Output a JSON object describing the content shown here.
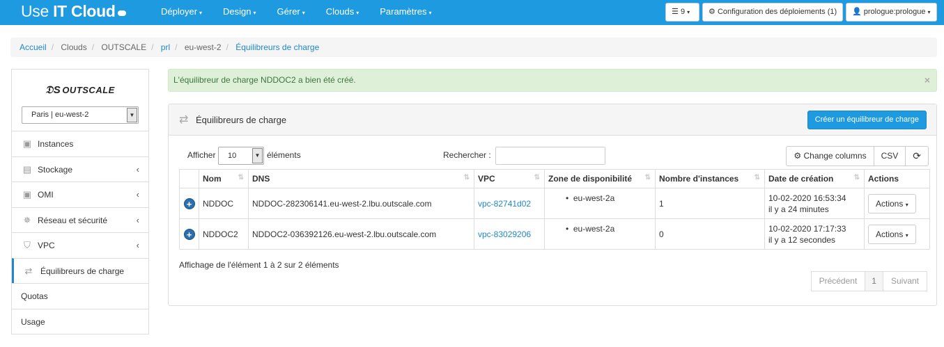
{
  "nav": {
    "brand_light": "Use ",
    "brand_bold": "IT Cloud",
    "menu": [
      "Déployer",
      "Design",
      "Gérer",
      "Clouds",
      "Paramètres"
    ],
    "tasks_count": "9",
    "config_label": "Configuration des déploiements (1)",
    "user_label": "prologue:prologue"
  },
  "breadcrumb": [
    "Accueil",
    "Clouds",
    "OUTSCALE",
    "prl",
    "eu-west-2",
    "Équilibreurs de charge"
  ],
  "sidebar": {
    "logo_text": "OUTSCALE",
    "region": "Paris | eu-west-2",
    "items": [
      {
        "label": "Instances",
        "icon": "chip-icon"
      },
      {
        "label": "Stockage",
        "icon": "storage-icon"
      },
      {
        "label": "OMI",
        "icon": "chip-icon"
      },
      {
        "label": "Réseau et sécurité",
        "icon": "network-icon"
      },
      {
        "label": "VPC",
        "icon": "shield-icon"
      },
      {
        "label": "Équilibreurs de charge",
        "icon": "exchange-icon"
      },
      {
        "label": "Quotas"
      },
      {
        "label": "Usage"
      }
    ]
  },
  "alert": {
    "message": "L'équilibreur de charge NDDOC2 a bien été créé.",
    "close": "×"
  },
  "panel": {
    "title": "Équilibreurs de charge",
    "create_button": "Créer un équilibreur de charge",
    "show_label": "Afficher",
    "page_length": "10",
    "elements_label": "éléments",
    "search_label": "Rechercher :",
    "search_value": "",
    "change_columns": "Change columns",
    "csv": "CSV"
  },
  "table": {
    "headers": [
      "Nom",
      "DNS",
      "VPC",
      "Zone de disponibilité",
      "Nombre d'instances",
      "Date de création",
      "Actions"
    ],
    "rows": [
      {
        "name": "NDDOC",
        "dns": "NDDOC-282306141.eu-west-2.lbu.outscale.com",
        "vpc": "vpc-82741d02",
        "zone": "eu-west-2a",
        "instances": "1",
        "date": "10-02-2020 16:53:34",
        "ago": "il y a 24 minutes",
        "action": "Actions"
      },
      {
        "name": "NDDOC2",
        "dns": "NDDOC2-036392126.eu-west-2.lbu.outscale.com",
        "vpc": "vpc-83029206",
        "zone": "eu-west-2a",
        "instances": "0",
        "date": "10-02-2020 17:17:33",
        "ago": "il y a 12 secondes",
        "action": "Actions"
      }
    ]
  },
  "footer": {
    "info": "Affichage de l'élément 1 à 2 sur 2 éléments",
    "prev": "Précédent",
    "page": "1",
    "next": "Suivant"
  }
}
